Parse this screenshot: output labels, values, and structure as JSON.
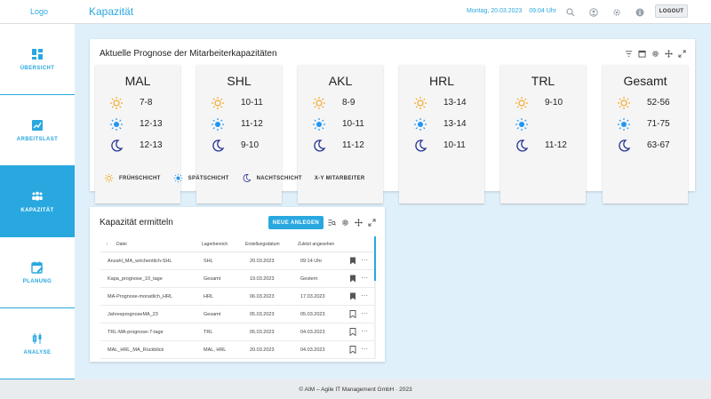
{
  "header": {
    "logo": "Logo",
    "title": "Kapazität",
    "date": "Montag, 20.03.2023",
    "time": "09:04 Uhr",
    "icons": [
      "search-icon",
      "account-icon",
      "settings-icon",
      "info-icon"
    ],
    "logout_label": "LOGOUT"
  },
  "sidebar": {
    "items": [
      {
        "label": "ÜBERSICHT",
        "icon": "dashboard-icon",
        "active": false
      },
      {
        "label": "ARBEITSLAST",
        "icon": "chart-icon",
        "active": false
      },
      {
        "label": "KAPAZITÄT",
        "icon": "people-icon",
        "active": true
      },
      {
        "label": "PLANUNG",
        "icon": "calendar-edit-icon",
        "active": false
      },
      {
        "label": "ANALYSE",
        "icon": "candlestick-icon",
        "active": false
      }
    ]
  },
  "forecast": {
    "title": "Aktuelle Prognose der Mitarbeiterkapazitäten",
    "tools": [
      "filter-icon",
      "calendar-icon",
      "settings-icon",
      "move-icon",
      "expand-icon"
    ],
    "columns": [
      {
        "name": "MAL",
        "early": "7-8",
        "late": "12-13",
        "night": "12-13"
      },
      {
        "name": "SHL",
        "early": "10-11",
        "late": "11-12",
        "night": "9-10"
      },
      {
        "name": "AKL",
        "early": "8-9",
        "late": "10-11",
        "night": "11-12"
      },
      {
        "name": "HRL",
        "early": "13-14",
        "late": "13-14",
        "night": "10-11"
      },
      {
        "name": "TRL",
        "early": "9-10",
        "late": "",
        "night": "11-12"
      },
      {
        "name": "Gesamt",
        "early": "52-56",
        "late": "71-75",
        "night": "63-67"
      }
    ],
    "legend": {
      "early": "FRÜHSCHICHT",
      "late": "SPÄTSCHICHT",
      "night": "NACHTSCHICHT",
      "staff": "X-Y MITARBEITER"
    }
  },
  "colors": {
    "accent": "#29a8e0",
    "early": "#f5a623",
    "late": "#2196f3",
    "night": "#283593"
  },
  "capacity_table": {
    "title": "Kapazität ermitteln",
    "new_button": "NEUE ANLEGEN",
    "tools": [
      "search-list-icon",
      "settings-icon",
      "move-icon",
      "expand-icon"
    ],
    "headers": [
      "Datei",
      "Lagerbereich",
      "Erstellungsdatum",
      "Zuletzt angesehen"
    ],
    "rows": [
      {
        "file": "Anzahl_MA_wöchentlich-SHL",
        "area": "SHL",
        "created": "20.03.2023",
        "viewed": "09:14 Uhr",
        "bookmarked": true
      },
      {
        "file": "Kapa_prognose_10_tage",
        "area": "Gesamt",
        "created": "19.03.2023",
        "viewed": "Gestern",
        "bookmarked": true
      },
      {
        "file": "MA-Prognose-monatlich_HRL",
        "area": "HRL",
        "created": "06.03.2023",
        "viewed": "17.03.2023",
        "bookmarked": true
      },
      {
        "file": "JahresprognoseMA_23",
        "area": "Gesamt",
        "created": "05.03.2023",
        "viewed": "05.03.2023",
        "bookmarked": false
      },
      {
        "file": "TRL-MA-prognose-7-tage",
        "area": "TRL",
        "created": "05.03.2023",
        "viewed": "04.03.2023",
        "bookmarked": false
      },
      {
        "file": "MAL_HRL_MA_Rückblick",
        "area": "MAL, HRL",
        "created": "20.03.2023",
        "viewed": "04.03.2023",
        "bookmarked": false
      }
    ],
    "more_label": "···"
  },
  "footer": {
    "text": "© AIM – Agile IT Management GmbH · 2023"
  }
}
